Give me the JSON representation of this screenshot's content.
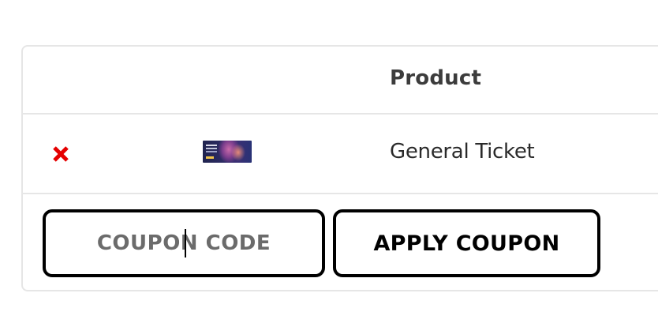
{
  "cart": {
    "header": {
      "product_label": "Product"
    },
    "items": [
      {
        "remove_icon": "close-x-icon",
        "thumbnail": "event-ticket-thumbnail",
        "name": "General Ticket"
      }
    ]
  },
  "coupon": {
    "placeholder": "COUPON CODE",
    "value": "",
    "apply_label": "APPLY COUPON"
  },
  "colors": {
    "remove_icon": "#e50000",
    "border": "#e6e6e6",
    "button_border": "#000000",
    "placeholder_text": "#6b6b6b"
  }
}
